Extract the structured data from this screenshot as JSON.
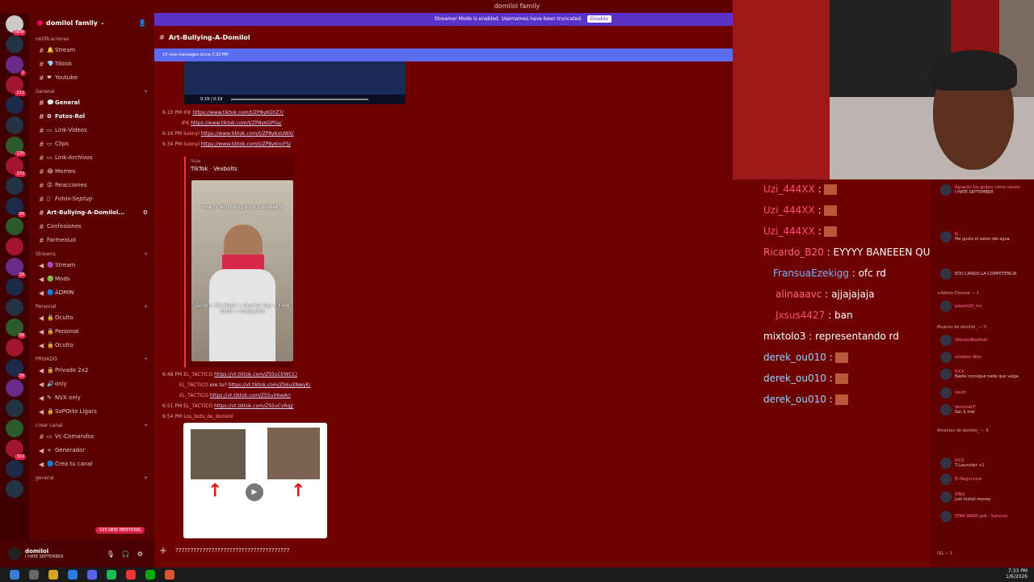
{
  "window": {
    "title": "domilol family"
  },
  "streamer_banner": {
    "text": "Streamer Mode is enabled. Usernames have been truncated.",
    "button": "Disable"
  },
  "server": {
    "name": "domilol family"
  },
  "sidebar": {
    "categories": [
      "notificaciones",
      "General",
      "Streams",
      "Personal",
      "PRIVADO",
      "crear canal",
      "general"
    ],
    "channels": [
      {
        "label": "Stream"
      },
      {
        "label": "Tiktok"
      },
      {
        "label": "Youtube"
      },
      {
        "label": "General"
      },
      {
        "label": "Fotos-Rol"
      },
      {
        "label": "Link-Videos"
      },
      {
        "label": "Clips"
      },
      {
        "label": "Link-Archivos"
      },
      {
        "label": "Memes"
      },
      {
        "label": "Reacciones"
      },
      {
        "label": "Fotos-Septup"
      },
      {
        "label": "Art-Bullying-A-Domilol..."
      },
      {
        "label": "Confesiones"
      },
      {
        "label": "FarmeoLol"
      },
      {
        "label": "Stream"
      },
      {
        "label": "Mods"
      },
      {
        "label": "ADMIN"
      },
      {
        "label": "Oculto"
      },
      {
        "label": "Personal"
      },
      {
        "label": "Oculto"
      },
      {
        "label": "Privado 2x2"
      },
      {
        "label": "only"
      },
      {
        "label": "NVX only"
      },
      {
        "label": "SoPOrte Ligars"
      },
      {
        "label": "Vc-Comandos"
      },
      {
        "label": "Generador"
      },
      {
        "label": "Crea tu canal"
      }
    ],
    "mentions": "193 NEW MENTIONS"
  },
  "user_panel": {
    "name": "domilol",
    "status": "I HATE SEPTEMBER"
  },
  "chat": {
    "channel": "Art-Bullying-A-Domilol",
    "new_messages": "10 new messages since 7:32 PM",
    "video1_time": "0:19 / 0:19",
    "lines1": [
      {
        "time": "6:10 PM",
        "user": "IFK",
        "link": "https://www.tiktok.com/t/ZP8yKGYZ7/"
      },
      {
        "time": "",
        "user": "IFK",
        "link": "https://www.tiktok.com/t/ZP8yKGPSa/"
      },
      {
        "time": "6:16 PM",
        "user": "luixnyl",
        "link": "https://www.tiktok.com/t/ZP8yKxUWX/"
      },
      {
        "time": "6:34 PM",
        "user": "luixnyl",
        "link": "https://www.tiktok.com/t/ZP8yKncFS/"
      }
    ],
    "embed": {
      "provider": "TikTok",
      "title": "TikTok · Vexbolts",
      "caption_top": "How to Activate phonk EssDeeKid",
      "caption_bottom": "Grills + Ski Mask + Quarter Zip + Flow State + Essdeekid"
    },
    "lines2": [
      {
        "time": "6:48 PM",
        "user": "EL_TACTICO",
        "prefix": "",
        "link": "https://vt.tiktok.com/ZS5uCEWCC/"
      },
      {
        "time": "",
        "user": "EL_TACTICO",
        "prefix": "ere tu?",
        "link": "https://vt.tiktok.com/ZS6uXNwyK/"
      },
      {
        "time": "",
        "user": "EL_TACTICO",
        "prefix": "",
        "link": "https://vt.tiktok.com/ZS5uX6wAr/"
      },
      {
        "time": "6:51 PM",
        "user": "EL_TACTICO",
        "prefix": "",
        "link": "https://vt.tiktok.com/ZS5uCvRgJ/"
      },
      {
        "time": "6:54 PM",
        "user": "Los_bots_de_domilol",
        "prefix": "",
        "link": ""
      }
    ],
    "composer_text": "??????????????????????????????????????"
  },
  "stream_chat": [
    {
      "user": "Uzi_444XX",
      "text": " :"
    },
    {
      "user": "Uzi_444XX",
      "text": " :"
    },
    {
      "user": "Uzi_444XX",
      "text": " :"
    },
    {
      "user": "Ricardo_B20",
      "text": " : EYYYY BANEEEN QUE MANDE TIKTOK"
    },
    {
      "user": "FransuaEzekigg",
      "text": " : ofc rd"
    },
    {
      "user": "alinaaavc",
      "text": " : ajjajajaja"
    },
    {
      "user": "Jxsus4427",
      "text": " : ban"
    },
    {
      "user": "mixtolo3",
      "text": " : representando rd"
    },
    {
      "user": "derek_ou010",
      "text": " :"
    },
    {
      "user": "derek_ou010",
      "text": " :"
    },
    {
      "user": "derek_ou010",
      "text": " :"
    }
  ],
  "members": {
    "groups": [
      "+Admin-Discord — 1",
      "Mujeres de domilol_ — 5",
      "Amantes de domilol_ — 6",
      "OG — 1"
    ],
    "items": [
      {
        "name": "Aguanto los golpes como vieses",
        "sub": "I HATE SEPTEMBER"
      },
      {
        "name": "N...",
        "sub": "Me gusta el sabor del agua"
      },
      {
        "name": "EDU CANDO LA COMPETENCIA",
        "sub": ""
      },
      {
        "name": "papolo20_mx",
        "sub": ""
      },
      {
        "name": "(Bonao)Nostloel",
        "sub": ""
      },
      {
        "name": "esteban dido",
        "sub": ""
      },
      {
        "name": "KICK",
        "sub": "Nadie consigue nada que valga"
      },
      {
        "name": "twistt",
        "sub": ""
      },
      {
        "name": "VentureCF",
        "sub": "Sal, k mal"
      },
      {
        "name": "KICK",
        "sub": "T-Launcher +1"
      },
      {
        "name": "El Negro Lore",
        "sub": ""
      },
      {
        "name": "KING",
        "sub": "Just install money"
      },
      {
        "name": "STAR WARS Jedi - Survivor",
        "sub": ""
      }
    ]
  },
  "taskbar": {
    "time": "7:33 PM",
    "date": "1/6/2026"
  }
}
